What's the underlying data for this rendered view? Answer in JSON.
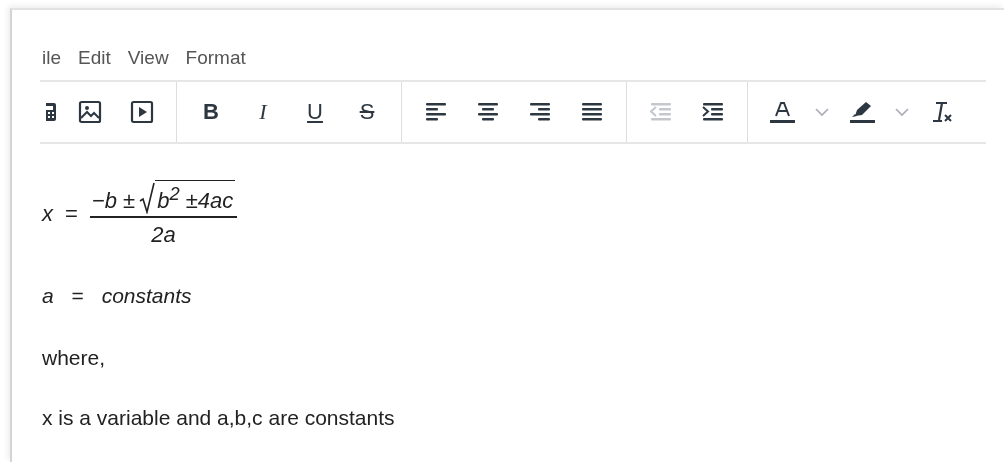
{
  "menu": [
    {
      "label": "ile"
    },
    {
      "label": "Edit"
    },
    {
      "label": "View"
    },
    {
      "label": "Format"
    }
  ],
  "toolbar": [
    [
      {
        "kind": "calculator",
        "disabled": false
      },
      {
        "kind": "image",
        "disabled": false
      },
      {
        "kind": "video",
        "disabled": false
      }
    ],
    [
      {
        "kind": "bold",
        "label": "B",
        "disabled": false
      },
      {
        "kind": "italic",
        "label": "I",
        "disabled": false
      },
      {
        "kind": "underline",
        "label": "U",
        "disabled": false
      },
      {
        "kind": "strikethrough",
        "label": "S",
        "disabled": false
      }
    ],
    [
      {
        "kind": "align-left",
        "disabled": false
      },
      {
        "kind": "align-center",
        "disabled": false
      },
      {
        "kind": "align-right",
        "disabled": false
      },
      {
        "kind": "justify",
        "disabled": false
      }
    ],
    [
      {
        "kind": "outdent",
        "disabled": true
      },
      {
        "kind": "indent",
        "disabled": false
      }
    ],
    [
      {
        "kind": "font-color",
        "disabled": false
      },
      {
        "kind": "chevron",
        "disabled": false
      },
      {
        "kind": "highlight",
        "disabled": false
      },
      {
        "kind": "chevron",
        "disabled": false
      },
      {
        "kind": "clear-format",
        "disabled": false
      }
    ]
  ],
  "formula": {
    "lhs": "x",
    "relation": "=",
    "numerator_prefix": "−b ±",
    "radicand": "b$^{2}$ ±4ac",
    "denominator": "2a"
  },
  "definition": {
    "lhs": "a",
    "relation": "=",
    "rhs": "constants"
  },
  "paragraphs": [
    "where,",
    "x is a variable and a,b,c are constants"
  ]
}
